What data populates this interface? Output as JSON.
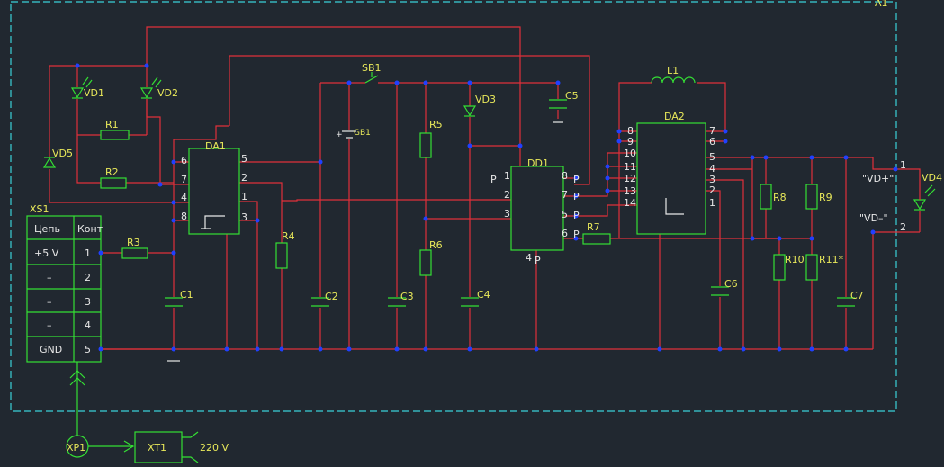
{
  "frame_label": "A1",
  "components": {
    "VD1": "VD1",
    "VD2": "VD2",
    "VD3": "VD3",
    "VD4": "VD4",
    "VD5": "VD5",
    "R1": "R1",
    "R2": "R2",
    "R3": "R3",
    "R4": "R4",
    "R5": "R5",
    "R6": "R6",
    "R7": "R7",
    "R8": "R8",
    "R9": "R9",
    "R10": "R10",
    "R11": "R11*",
    "C1": "C1",
    "C2": "C2",
    "C3": "C3",
    "C4": "C4",
    "C5": "C5",
    "C6": "C6",
    "C7": "C7",
    "DA1": "DA1",
    "DA2": "DA2",
    "DD1": "DD1",
    "L1": "L1",
    "SB1": "SB1",
    "GB1": "GB1",
    "XS1": "XS1",
    "XP1": "XP1",
    "XT1": "XT1"
  },
  "connector_table": {
    "header": [
      "Цепь",
      "Конт"
    ],
    "rows": [
      [
        "+5  V",
        "1"
      ],
      [
        "–",
        "2"
      ],
      [
        "–",
        "3"
      ],
      [
        "–",
        "4"
      ],
      [
        "GND",
        "5"
      ]
    ]
  },
  "mains_label": "220  V",
  "vd_plus": "\"VD+\"",
  "vd_minus": "\"VD–\"",
  "vd_pin1": "1",
  "vd_pin2": "2",
  "da1_pins": {
    "p6": "6",
    "p7": "7",
    "p4": "4",
    "p8": "8",
    "p5": "5",
    "p2": "2",
    "p1": "1",
    "p3": "3"
  },
  "dd1_pins": {
    "p1": "1",
    "p2": "2",
    "p3": "3",
    "p8": "8",
    "p7": "7",
    "p5": "5",
    "p6": "6",
    "p4": "4",
    "P": "P"
  },
  "da2_pins_left": [
    "8",
    "9",
    "10",
    "11",
    "12",
    "13",
    "14"
  ],
  "da2_pins_right": [
    "7",
    "6",
    "5",
    "4",
    "3",
    "2",
    "1"
  ]
}
